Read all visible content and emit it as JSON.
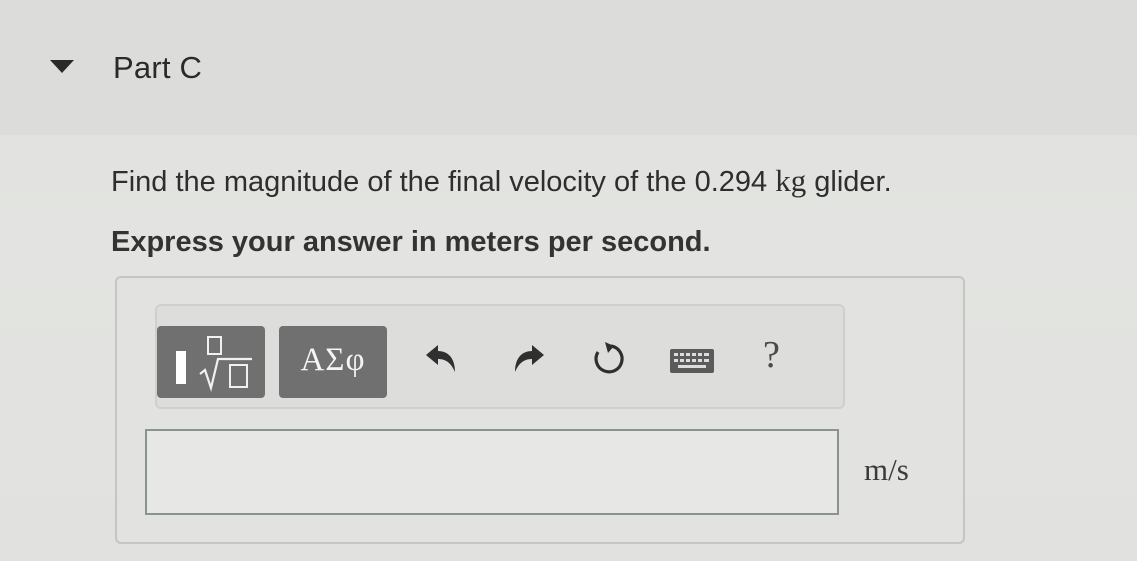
{
  "part": {
    "title": "Part C"
  },
  "question": {
    "text_before": "Find the magnitude of the final velocity of the ",
    "value": "0.294",
    "unit": "kg",
    "text_after": " glider.",
    "instruction": "Express your answer in meters per second."
  },
  "toolbar": {
    "templates_icon": "fraction-sqrt-template-icon",
    "symbols_label": "ΑΣφ",
    "undo_icon": "undo-arrow-icon",
    "redo_icon": "redo-arrow-icon",
    "reset_icon": "reset-icon",
    "keyboard_icon": "keyboard-icon",
    "help_label": "?"
  },
  "answer": {
    "value": "",
    "placeholder": "",
    "units": "m/s"
  },
  "colors": {
    "button_bg": "#707070",
    "input_border": "#8a9394",
    "text": "#2b2b2b"
  }
}
